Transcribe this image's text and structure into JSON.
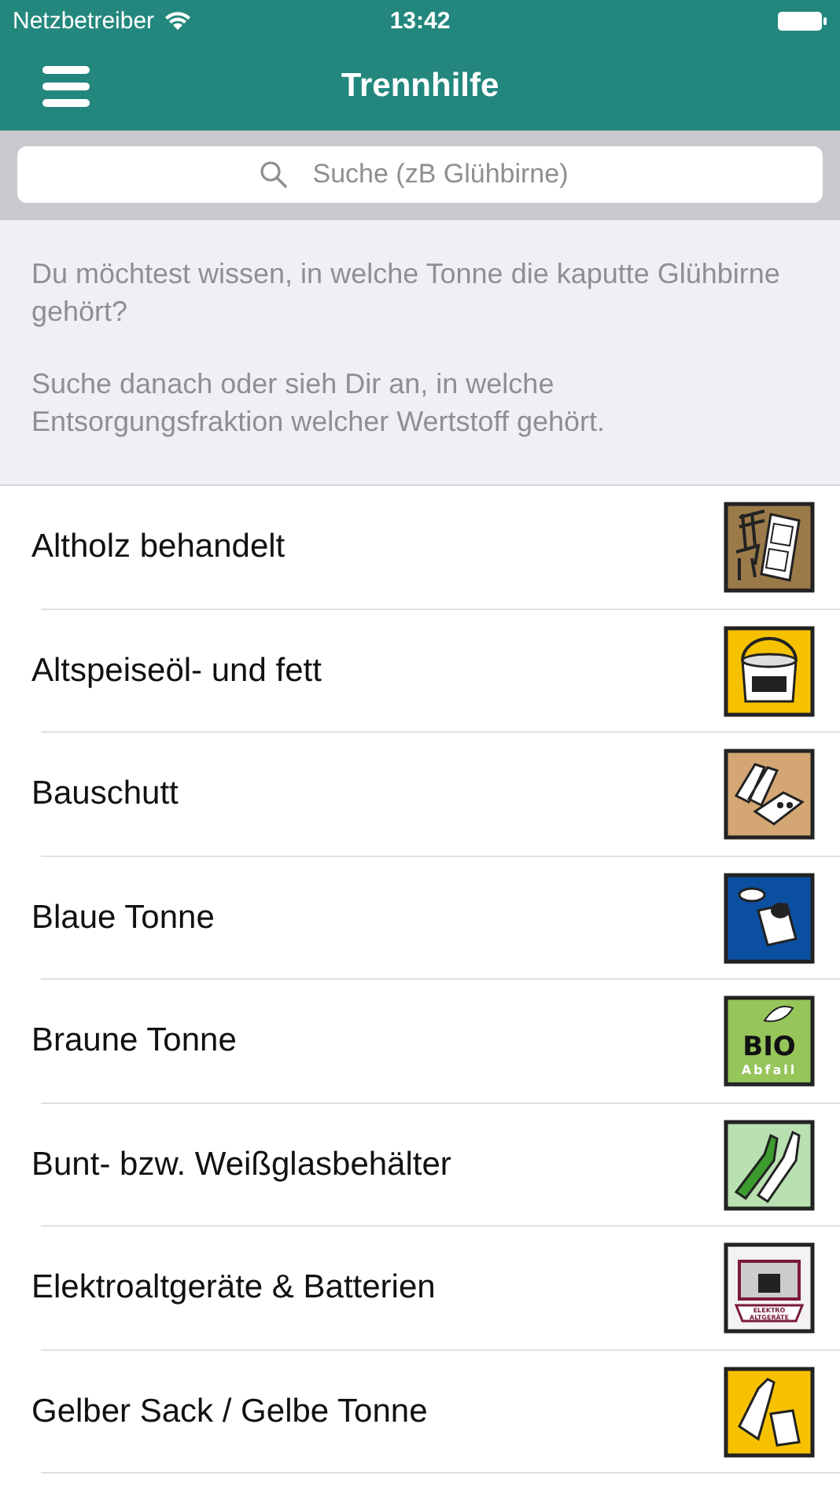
{
  "status_bar": {
    "carrier": "Netzbetreiber",
    "time": "13:42"
  },
  "nav": {
    "title": "Trennhilfe"
  },
  "search": {
    "placeholder": "Suche (zB Glühbirne)"
  },
  "intro": [
    "Du möchtest wissen, in welche Tonne die kaputte Glühbirne gehört?",
    "Suche danach oder sieh Dir an, in welche Entsorgungsfraktion welcher Wertstoff gehört."
  ],
  "items": [
    {
      "label": "Altholz behandelt",
      "kind": "wood",
      "color": "#9b7a4a"
    },
    {
      "label": "Altspeiseöl- und fett",
      "kind": "bucket",
      "color": "#f6c200"
    },
    {
      "label": "Bauschutt",
      "kind": "rubble",
      "color": "#d3a674"
    },
    {
      "label": "Blaue Tonne",
      "kind": "can",
      "color": "#0b4fa0"
    },
    {
      "label": "Braune Tonne",
      "kind": "bio",
      "color": "#96c55a",
      "icon_text": [
        "BIO",
        "Abfall"
      ]
    },
    {
      "label": "Bunt- bzw. Weißglasbehälter",
      "kind": "glass",
      "color": "#b8e0b0"
    },
    {
      "label": "Elektroaltgeräte & Batterien",
      "kind": "electro",
      "color": "#f4f2f3",
      "icon_text": [
        "ELEKTRO",
        "ALTGERÄTE"
      ]
    },
    {
      "label": "Gelber Sack / Gelbe Tonne",
      "kind": "bottle",
      "color": "#f6c200"
    }
  ]
}
